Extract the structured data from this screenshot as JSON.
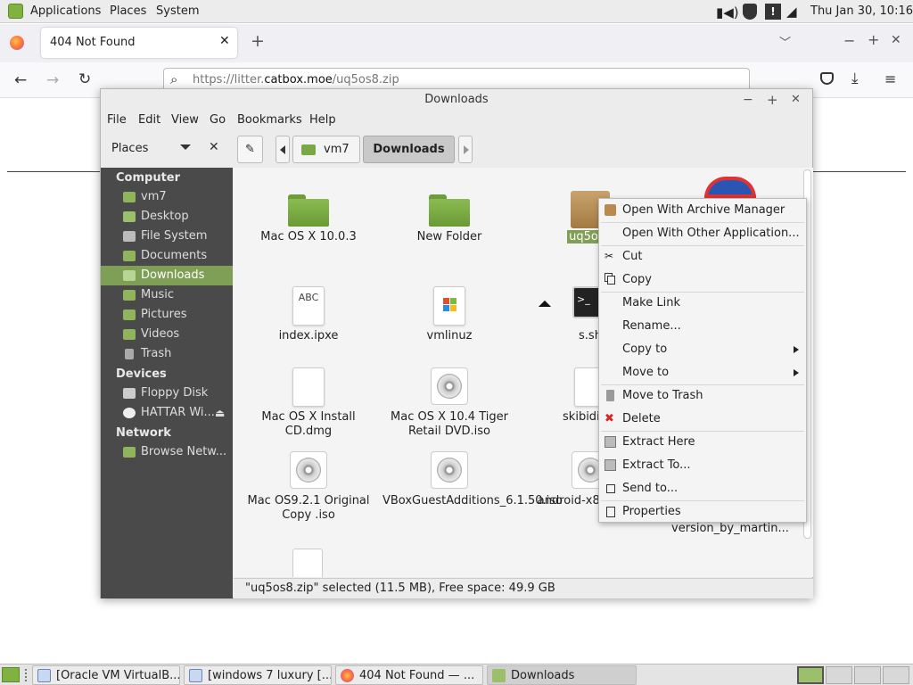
{
  "top_panel": {
    "menus": [
      "Applications",
      "Places",
      "System"
    ],
    "clock": "Thu Jan 30, 10:16"
  },
  "browser": {
    "tab_title": "404 Not Found",
    "url_prefix": "https://litter.",
    "url_domain": "catbox.moe",
    "url_path": "/uq5os8.zip"
  },
  "file_manager": {
    "title": "Downloads",
    "menus": [
      "File",
      "Edit",
      "View",
      "Go",
      "Bookmarks",
      "Help"
    ],
    "places_label": "Places",
    "path": [
      "vm7",
      "Downloads"
    ],
    "sidebar": {
      "computer_header": "Computer",
      "computer_items": [
        "vm7",
        "Desktop",
        "File System",
        "Documents",
        "Downloads",
        "Music",
        "Pictures",
        "Videos",
        "Trash"
      ],
      "devices_header": "Devices",
      "devices_items": [
        "Floppy Disk",
        "HATTAR Wi..."
      ],
      "network_header": "Network",
      "network_items": [
        "Browse Netw..."
      ]
    },
    "items": [
      {
        "name": "Mac OS X 10.0.3",
        "type": "folder"
      },
      {
        "name": "New Folder",
        "type": "folder"
      },
      {
        "name": "uq5os8",
        "type": "archive"
      },
      {
        "name": "index.ipxe",
        "type": "text",
        "icon_label": "ABC"
      },
      {
        "name": "vmlinuz",
        "type": "windows"
      },
      {
        "name": "s.sh",
        "type": "script"
      },
      {
        "name": "Mac OS X Install CD.dmg",
        "type": "file"
      },
      {
        "name": "Mac OS X 10.4 Tiger Retail DVD.iso",
        "type": "disc"
      },
      {
        "name": "skibiditoil",
        "type": "file"
      },
      {
        "name": "Mac OS9.2.1 Original Copy .iso",
        "type": "disc"
      },
      {
        "name": "VBoxGuestAdditions_6.1.50.iso",
        "type": "disc"
      },
      {
        "name": "android-x86 r2.iso",
        "type": "disc"
      },
      {
        "name": "version_by_martin...",
        "type": "file"
      }
    ],
    "status": "\"uq5os8.zip\" selected (11.5 MB), Free space: 49.9 GB"
  },
  "context_menu": {
    "items": [
      {
        "label": "Open With Archive Manager",
        "icon": "archive-icon"
      },
      {
        "label": "Open With Other Application...",
        "icon": ""
      },
      {
        "label": "Cut",
        "icon": "scissors-icon"
      },
      {
        "label": "Copy",
        "icon": "copy-icon"
      },
      {
        "label": "Make Link",
        "icon": ""
      },
      {
        "label": "Rename...",
        "icon": ""
      },
      {
        "label": "Copy to",
        "icon": "",
        "submenu": true
      },
      {
        "label": "Move to",
        "icon": "",
        "submenu": true
      },
      {
        "label": "Move to Trash",
        "icon": "trash-icon"
      },
      {
        "label": "Delete",
        "icon": "delete-icon"
      },
      {
        "label": "Extract Here",
        "icon": "extract-icon"
      },
      {
        "label": "Extract To...",
        "icon": "extract-icon"
      },
      {
        "label": "Send to...",
        "icon": "send-icon"
      },
      {
        "label": "Properties",
        "icon": "properties-icon"
      }
    ]
  },
  "taskbar": {
    "tasks": [
      "[Oracle VM VirtualB...",
      "[windows 7 luxury [...",
      "404 Not Found — ...",
      "Downloads"
    ]
  }
}
